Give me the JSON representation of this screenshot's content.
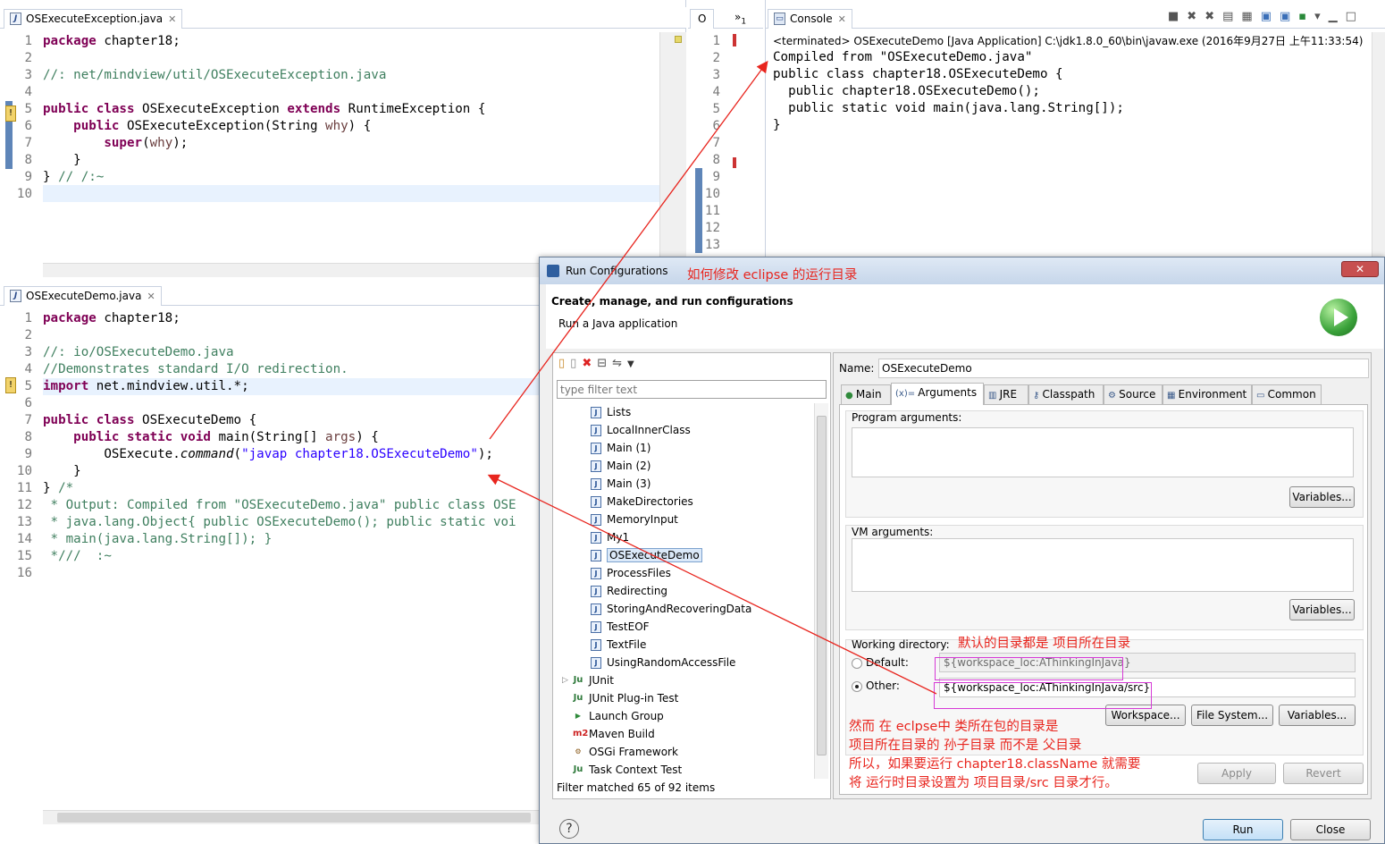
{
  "editor1": {
    "tab": "OSExecuteException.java",
    "lines": [
      {
        "n": "1",
        "parts": [
          {
            "k": "kw",
            "t": "package"
          },
          {
            "t": " chapter18;"
          }
        ]
      },
      {
        "n": "2",
        "parts": []
      },
      {
        "n": "3",
        "parts": [
          {
            "k": "cm",
            "t": "//: net/mindview/util/OSExecuteException.java"
          }
        ]
      },
      {
        "n": "4",
        "parts": []
      },
      {
        "n": "5",
        "parts": [
          {
            "k": "kw",
            "t": "public class"
          },
          {
            "t": " OSExecuteException "
          },
          {
            "k": "kw",
            "t": "extends"
          },
          {
            "t": " RuntimeException {"
          }
        ]
      },
      {
        "n": "6",
        "parts": [
          {
            "t": "    "
          },
          {
            "k": "kw",
            "t": "public"
          },
          {
            "t": " OSExecuteException(String "
          },
          {
            "k": "par",
            "t": "why"
          },
          {
            "t": ") {"
          }
        ]
      },
      {
        "n": "7",
        "parts": [
          {
            "t": "        "
          },
          {
            "k": "kw",
            "t": "super"
          },
          {
            "t": "("
          },
          {
            "k": "par",
            "t": "why"
          },
          {
            "t": ");"
          }
        ]
      },
      {
        "n": "8",
        "parts": [
          {
            "t": "    }"
          }
        ]
      },
      {
        "n": "9",
        "parts": [
          {
            "t": "} "
          },
          {
            "k": "cm",
            "t": "// /:~"
          }
        ]
      },
      {
        "n": "10",
        "parts": []
      }
    ]
  },
  "outline": {
    "tab1": "O",
    "tab2": "»",
    "tab2_count": "1",
    "lines": [
      "1",
      "2",
      "3",
      "4",
      "5",
      "6",
      "7",
      "8",
      "9",
      "10",
      "11",
      "12",
      "13"
    ]
  },
  "console": {
    "tab": "Console",
    "header": "<terminated> OSExecuteDemo [Java Application] C:\\jdk1.8.0_60\\bin\\javaw.exe (2016年9月27日 上午11:33:54)",
    "lines": [
      "Compiled from \"OSExecuteDemo.java\"",
      "public class chapter18.OSExecuteDemo {",
      "  public chapter18.OSExecuteDemo();",
      "  public static void main(java.lang.String[]);",
      "}"
    ]
  },
  "editor2": {
    "tab": "OSExecuteDemo.java",
    "lines": [
      {
        "n": "1",
        "parts": [
          {
            "k": "kw",
            "t": "package"
          },
          {
            "t": " chapter18;"
          }
        ]
      },
      {
        "n": "2",
        "parts": []
      },
      {
        "n": "3",
        "parts": [
          {
            "k": "cm",
            "t": "//: io/OSExecuteDemo.java"
          }
        ]
      },
      {
        "n": "4",
        "parts": [
          {
            "k": "cm",
            "t": "//Demonstrates standard I/O redirection."
          }
        ]
      },
      {
        "n": "5",
        "parts": [
          {
            "k": "kw",
            "t": "import"
          },
          {
            "t": " net.mindview.util.*;"
          }
        ]
      },
      {
        "n": "6",
        "parts": []
      },
      {
        "n": "7",
        "parts": [
          {
            "k": "kw",
            "t": "public class"
          },
          {
            "t": " OSExecuteDemo {"
          }
        ]
      },
      {
        "n": "8",
        "parts": [
          {
            "t": "    "
          },
          {
            "k": "kw",
            "t": "public static void"
          },
          {
            "t": " main(String[] "
          },
          {
            "k": "par",
            "t": "args"
          },
          {
            "t": ") {"
          }
        ]
      },
      {
        "n": "9",
        "parts": [
          {
            "t": "        OSExecute."
          },
          {
            "k": "it",
            "t": "command"
          },
          {
            "t": "("
          },
          {
            "k": "st",
            "t": "\"javap chapter18.OSExecuteDemo\""
          },
          {
            "t": ");"
          }
        ]
      },
      {
        "n": "10",
        "parts": [
          {
            "t": "    }"
          }
        ]
      },
      {
        "n": "11",
        "parts": [
          {
            "t": "} "
          },
          {
            "k": "cm",
            "t": "/*"
          }
        ]
      },
      {
        "n": "12",
        "parts": [
          {
            "k": "cm",
            "t": " * Output: Compiled from \"OSExecuteDemo.java\" public class OSE"
          }
        ]
      },
      {
        "n": "13",
        "parts": [
          {
            "k": "cm",
            "t": " * java.lang.Object{ public OSExecuteDemo(); public static voi"
          }
        ]
      },
      {
        "n": "14",
        "parts": [
          {
            "k": "cm",
            "t": " * main(java.lang.String[]); }"
          }
        ]
      },
      {
        "n": "15",
        "parts": [
          {
            "k": "cm",
            "t": " *///  :~"
          }
        ]
      },
      {
        "n": "16",
        "parts": []
      }
    ]
  },
  "dialog": {
    "title": "Run Configurations",
    "heading": "Create, manage, and run configurations",
    "subheading": "Run a Java application",
    "filter_placeholder": "type filter text",
    "tree_items": [
      {
        "label": "Lists",
        "level": 2,
        "icon": "J"
      },
      {
        "label": "LocalInnerClass",
        "level": 2,
        "icon": "J"
      },
      {
        "label": "Main (1)",
        "level": 2,
        "icon": "J"
      },
      {
        "label": "Main (2)",
        "level": 2,
        "icon": "J"
      },
      {
        "label": "Main (3)",
        "level": 2,
        "icon": "J"
      },
      {
        "label": "MakeDirectories",
        "level": 2,
        "icon": "J"
      },
      {
        "label": "MemoryInput",
        "level": 2,
        "icon": "J"
      },
      {
        "label": "My1",
        "level": 2,
        "icon": "J"
      },
      {
        "label": "OSExecuteDemo",
        "level": 2,
        "icon": "J",
        "selected": true
      },
      {
        "label": "ProcessFiles",
        "level": 2,
        "icon": "J"
      },
      {
        "label": "Redirecting",
        "level": 2,
        "icon": "J"
      },
      {
        "label": "StoringAndRecoveringData",
        "level": 2,
        "icon": "J"
      },
      {
        "label": "TestEOF",
        "level": 2,
        "icon": "J"
      },
      {
        "label": "TextFile",
        "level": 2,
        "icon": "J"
      },
      {
        "label": "UsingRandomAccessFile",
        "level": 2,
        "icon": "J"
      },
      {
        "label": "JUnit",
        "level": 1,
        "icon": "Ju",
        "expander": true
      },
      {
        "label": "JUnit Plug-in Test",
        "level": 1,
        "icon": "Ju"
      },
      {
        "label": "Launch Group",
        "level": 1,
        "icon": "play"
      },
      {
        "label": "Maven Build",
        "level": 1,
        "icon": "m2"
      },
      {
        "label": "OSGi Framework",
        "level": 1,
        "icon": "gear"
      },
      {
        "label": "Task Context Test",
        "level": 1,
        "icon": "Ju"
      }
    ],
    "filter_status": "Filter matched 65 of 92 items",
    "name_label": "Name:",
    "name_value": "OSExecuteDemo",
    "tabs": [
      "Main",
      "Arguments",
      "JRE",
      "Classpath",
      "Source",
      "Environment",
      "Common"
    ],
    "active_tab": "Arguments",
    "program_args_label": "Program arguments:",
    "vm_args_label": "VM arguments:",
    "variables_label": "Variables...",
    "working_dir_label": "Working directory:",
    "default_label": "Default:",
    "default_value": "${workspace_loc:AThinkingInJava}",
    "other_label": "Other:",
    "other_value": "${workspace_loc:AThinkingInJava/src}",
    "workspace_btn": "Workspace...",
    "filesystem_btn": "File System...",
    "apply_btn": "Apply",
    "revert_btn": "Revert",
    "run_btn": "Run",
    "close_btn": "Close",
    "help_icon": "?"
  },
  "annotations": {
    "title_note": "如何修改 eclipse 的运行目录",
    "default_note": "默认的目录都是 项目所在目录",
    "explain": [
      "然而 在 eclpse中 类所在包的目录是",
      "项目所在目录的 孙子目录 而不是 父目录",
      "所以，如果要运行 chapter18.className 就需要",
      "将 运行时目录设置为 项目目录/src 目录才行。"
    ]
  },
  "colors": {
    "annotation_red": "#e8251e",
    "box_magenta": "#d63ad6",
    "keyword": "#7f0055",
    "comment": "#3f7f5f",
    "string": "#2a00ff"
  }
}
